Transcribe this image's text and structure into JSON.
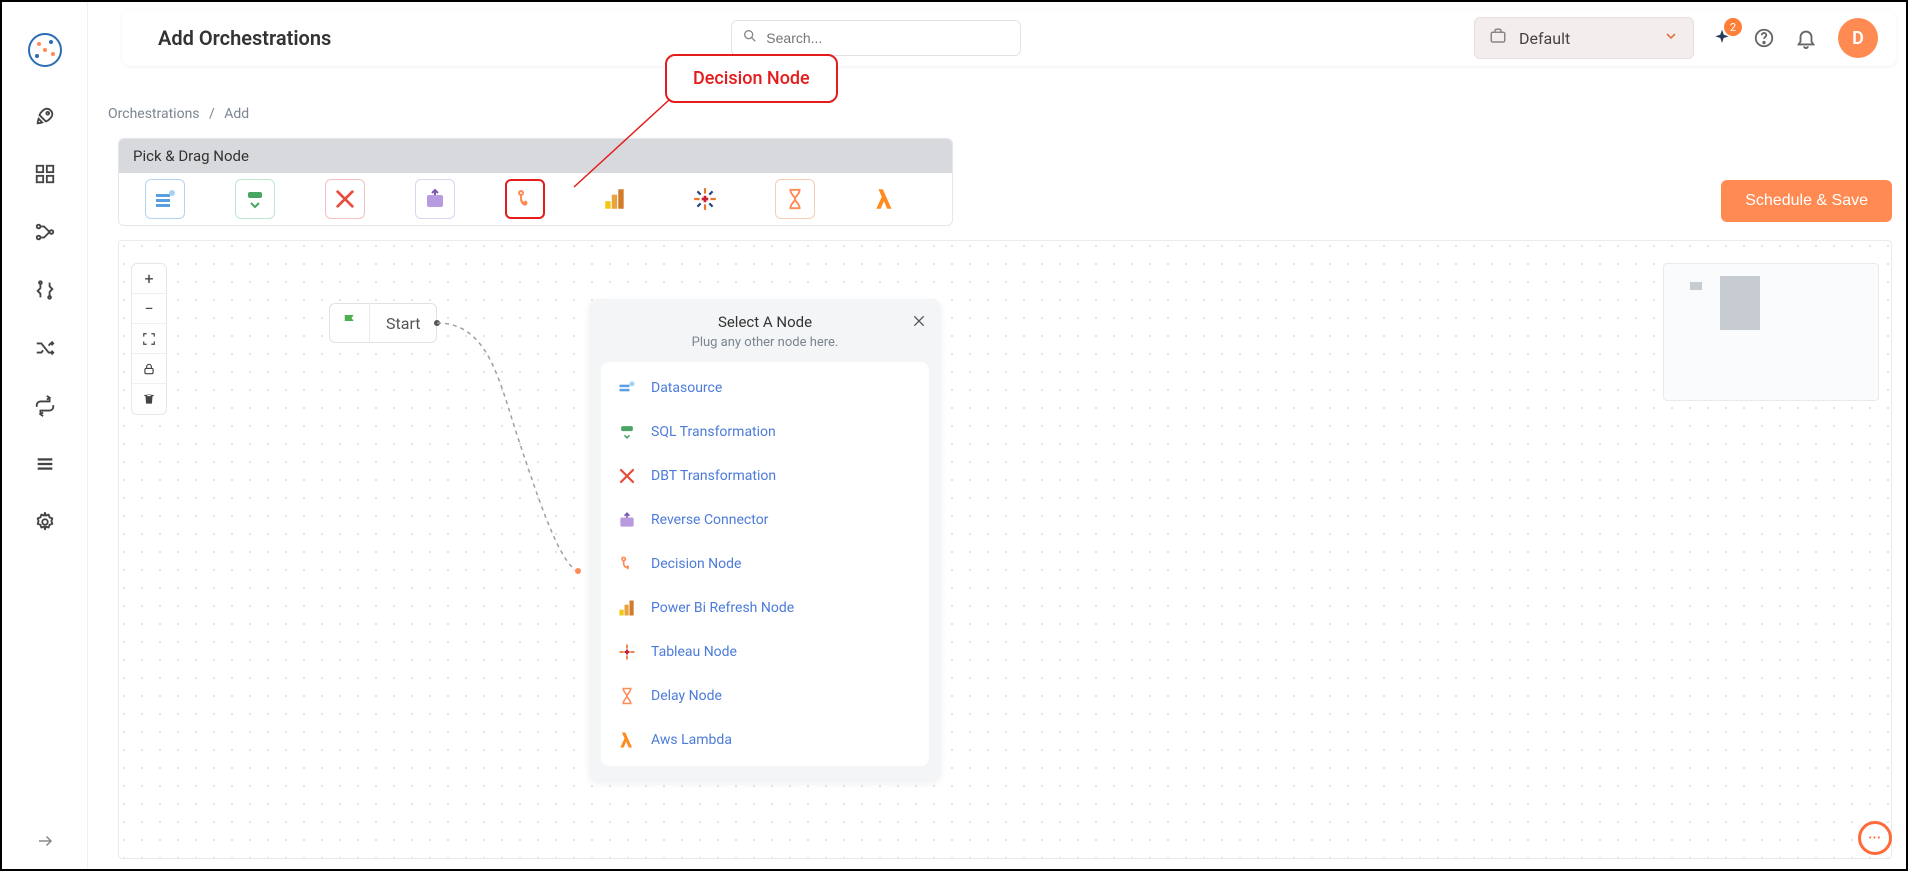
{
  "header": {
    "title": "Add Orchestrations",
    "search_placeholder": "Search...",
    "workspace_label": "Default",
    "notification_count": "2",
    "avatar_letter": "D"
  },
  "breadcrumbs": {
    "root": "Orchestrations",
    "current": "Add"
  },
  "toolbar": {
    "title": "Pick & Drag Node"
  },
  "callout": {
    "label": "Decision Node"
  },
  "actions": {
    "schedule_save": "Schedule & Save"
  },
  "start_node": {
    "label": "Start"
  },
  "popover": {
    "title": "Select A Node",
    "subtitle": "Plug any other node here.",
    "items": {
      "datasource": "Datasource",
      "sql": "SQL Transformation",
      "dbt": "DBT Transformation",
      "reverse": "Reverse Connector",
      "decision": "Decision Node",
      "powerbi": "Power Bi Refresh Node",
      "tableau": "Tableau Node",
      "delay": "Delay Node",
      "lambda": "Aws Lambda"
    }
  }
}
